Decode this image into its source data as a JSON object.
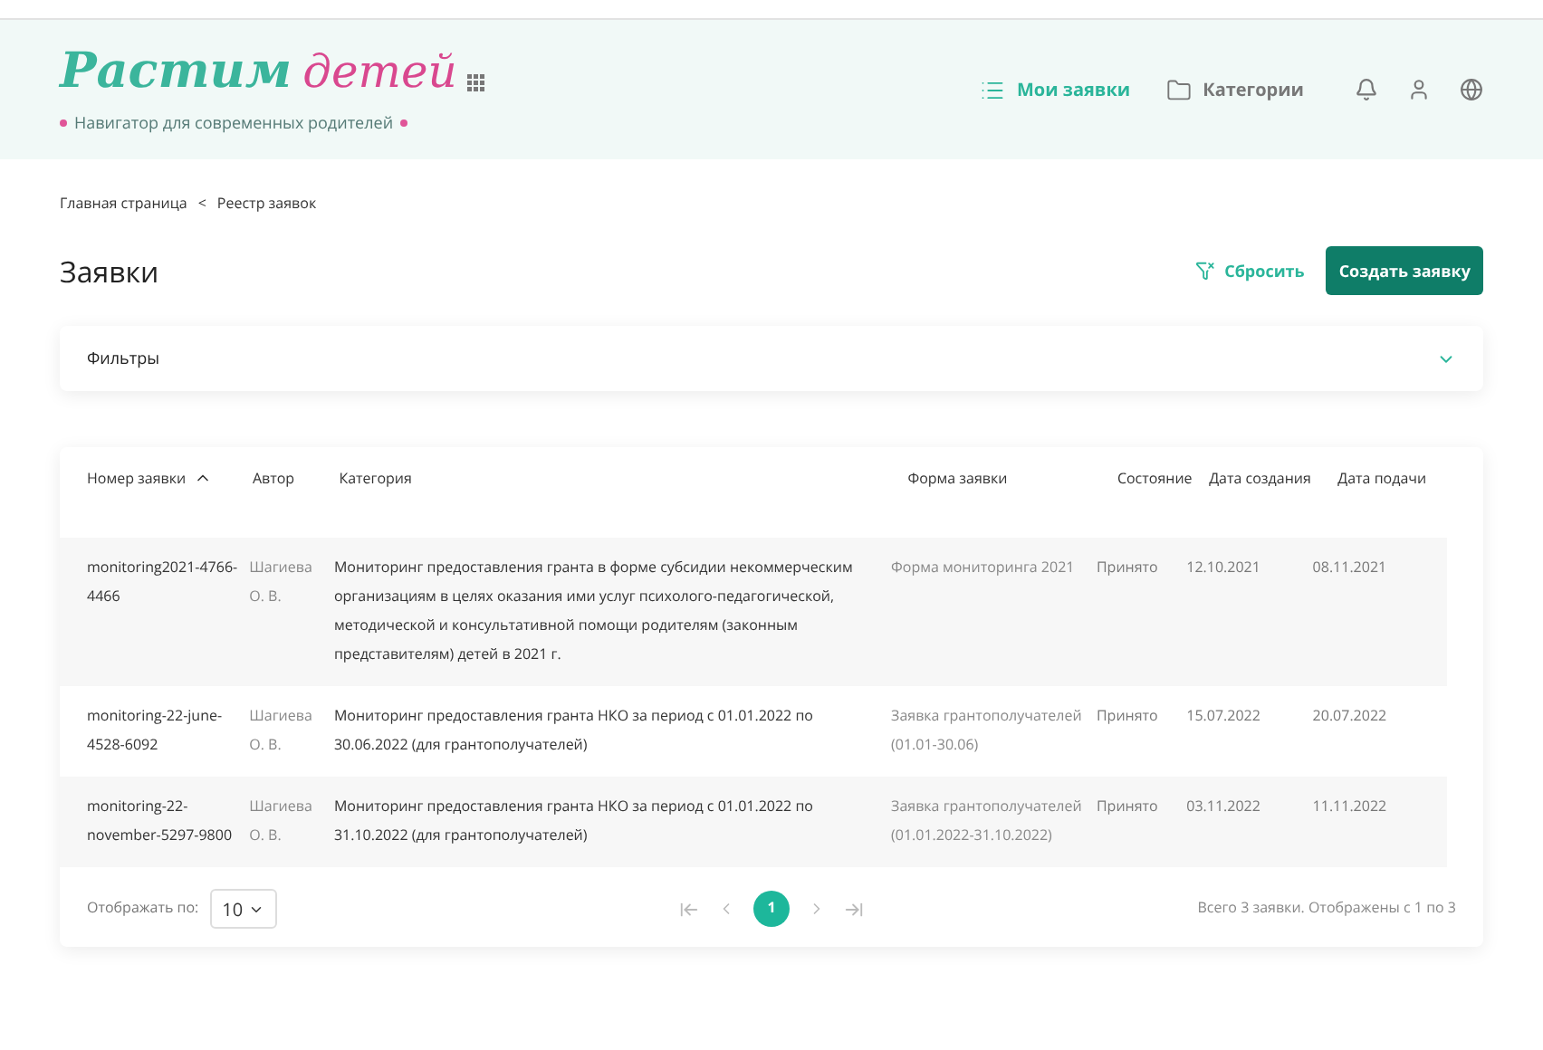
{
  "header": {
    "logo_main": "Растим",
    "logo_accent": "детей",
    "tagline": "Навигатор для современных родителей",
    "nav": [
      {
        "label": "Мои заявки",
        "kind": "list",
        "selected": true
      },
      {
        "label": "Категории",
        "kind": "folder",
        "selected": false
      }
    ]
  },
  "breadcrumbs": [
    "Главная страница",
    "Реестр заявок"
  ],
  "breadcrumb_separator": "<",
  "page_title": "Заявки",
  "reset_button": "Сбросить",
  "create_button": "Создать заявку",
  "filters": {
    "label": "Фильтры",
    "expanded": false
  },
  "table": {
    "columns": [
      {
        "label": "Номер заявки",
        "sorted": true
      },
      {
        "label": "Автор",
        "sorted": false
      },
      {
        "label": "Категория",
        "sorted": false
      },
      {
        "label": "Форма заявки",
        "sorted": false
      },
      {
        "label": "Состояние",
        "sorted": false
      },
      {
        "label": "Дата создания",
        "sorted": false
      },
      {
        "label": "Дата подачи",
        "sorted": false
      }
    ],
    "rows": [
      [
        "monitoring2021-4766-4466",
        "Шагиева О. В.",
        "Мониторинг предоставления гранта в форме субсидии некоммерческим организациям в целях оказания ими услуг психолого-педагогической, методической и консультативной помощи родителям (законным представителям) детей в 2021 г.",
        "Форма мониторинга 2021",
        "Принято",
        "12.10.2021",
        "08.11.2021"
      ],
      [
        "monitoring-22-june-4528-6092",
        "Шагиева О. В.",
        "Мониторинг предоставления гранта НКО за период с 01.01.2022 по 30.06.2022 (для грантополучателей)",
        "Заявка грантополучателей (01.01-30.06)",
        "Принято",
        "15.07.2022",
        "20.07.2022"
      ],
      [
        "monitoring-22-november-5297-9800",
        "Шагиева О. В.",
        "Мониторинг предоставления гранта НКО за период с 01.01.2022 по 31.10.2022 (для грантополучателей)",
        "Заявка грантополучателей (01.01.2022-31.10.2022)",
        "Принято",
        "03.11.2022",
        "11.11.2022"
      ]
    ]
  },
  "pagination": {
    "per_page_label": "Отображать по:",
    "per_page": "10",
    "pages": [
      {
        "label": "1",
        "selected": true
      }
    ],
    "summary": "Всего 3 заявки. Отображены с 1 по 3"
  }
}
